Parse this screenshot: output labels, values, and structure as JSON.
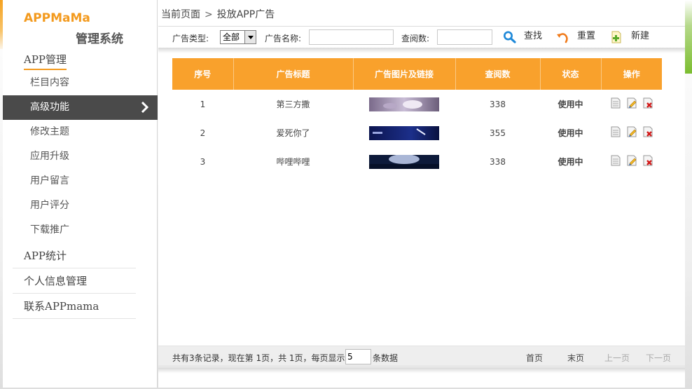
{
  "brand": {
    "name": "APPMaMa",
    "subtitle": "管理系统"
  },
  "sidebar": {
    "groups": [
      {
        "label": "APP管理"
      },
      {
        "label": "APP统计"
      },
      {
        "label": "个人信息管理"
      },
      {
        "label": "联系APPmama"
      }
    ],
    "items": [
      {
        "label": "栏目内容"
      },
      {
        "label": "高级功能"
      },
      {
        "label": "修改主题"
      },
      {
        "label": "应用升级"
      },
      {
        "label": "用户留言"
      },
      {
        "label": "用户评分"
      },
      {
        "label": "下载推广"
      }
    ]
  },
  "breadcrumb": {
    "current_label": "当前页面",
    "page": "投放APP广告"
  },
  "toolbar": {
    "type_label": "广告类型:",
    "type_value": "全部",
    "name_label": "广告名称:",
    "name_value": "",
    "views_label": "查阅数:",
    "views_value": "",
    "search_label": "查找",
    "reset_label": "重置",
    "new_label": "新建"
  },
  "table": {
    "headers": [
      "序号",
      "广告标题",
      "广告图片及链接",
      "查阅数",
      "状态",
      "操作"
    ],
    "rows": [
      {
        "no": "1",
        "title": "第三方撒",
        "views": "338",
        "status": "使用中"
      },
      {
        "no": "2",
        "title": "爱死你了",
        "views": "355",
        "status": "使用中"
      },
      {
        "no": "3",
        "title": "哔哩哔哩",
        "views": "338",
        "status": "使用中"
      }
    ]
  },
  "pagination": {
    "summary": "共有3条记录，现在第 1页，共 1页，每页显示",
    "page_size": "5",
    "suffix": "条数据",
    "first": "首页",
    "last": "末页",
    "prev": "上一页",
    "next": "下一页"
  },
  "colors": {
    "accent": "#f9a12c",
    "brand": "#f39a1e",
    "status": "#1a2a8a",
    "green": "#7bbd2f"
  }
}
